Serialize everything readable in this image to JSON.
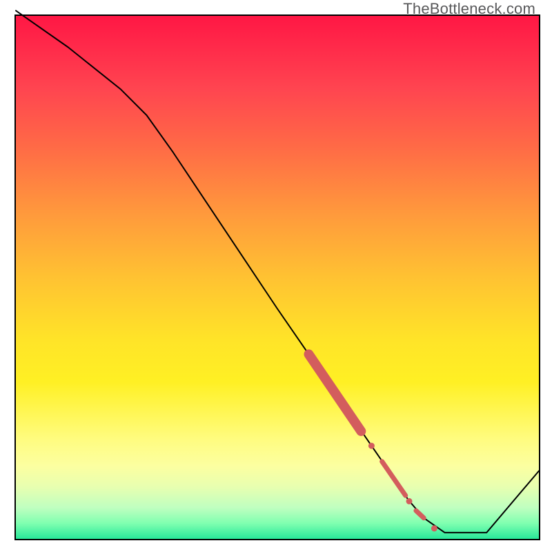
{
  "watermark": "TheBottleneck.com",
  "chart_data": {
    "type": "line",
    "title": "",
    "xlabel": "",
    "ylabel": "",
    "xlim": [
      0,
      100
    ],
    "ylim": [
      0,
      100
    ],
    "series": [
      {
        "name": "curve",
        "x": [
          0,
          10,
          20,
          25,
          30,
          40,
          50,
          60,
          68,
          72,
          75,
          78,
          82,
          90,
          100
        ],
        "y": [
          101,
          94,
          86,
          81,
          74,
          59,
          44,
          29.5,
          17.8,
          12,
          7.5,
          4,
          1.2,
          1.2,
          13
        ]
      }
    ],
    "highlights": [
      {
        "name": "thick",
        "x": [
          56,
          66
        ],
        "y": [
          35.3,
          20.6
        ]
      },
      {
        "name": "thin1",
        "x": [
          70,
          74.5
        ],
        "y": [
          14.8,
          8.3
        ]
      },
      {
        "name": "thin2",
        "x": [
          76.5,
          78
        ],
        "y": [
          5.4,
          4
        ]
      }
    ],
    "markers": [
      {
        "x": 68,
        "y": 17.8,
        "r": 4.5
      },
      {
        "x": 75.2,
        "y": 7.2,
        "r": 4.5
      },
      {
        "x": 80,
        "y": 2,
        "r": 4.5
      }
    ]
  }
}
